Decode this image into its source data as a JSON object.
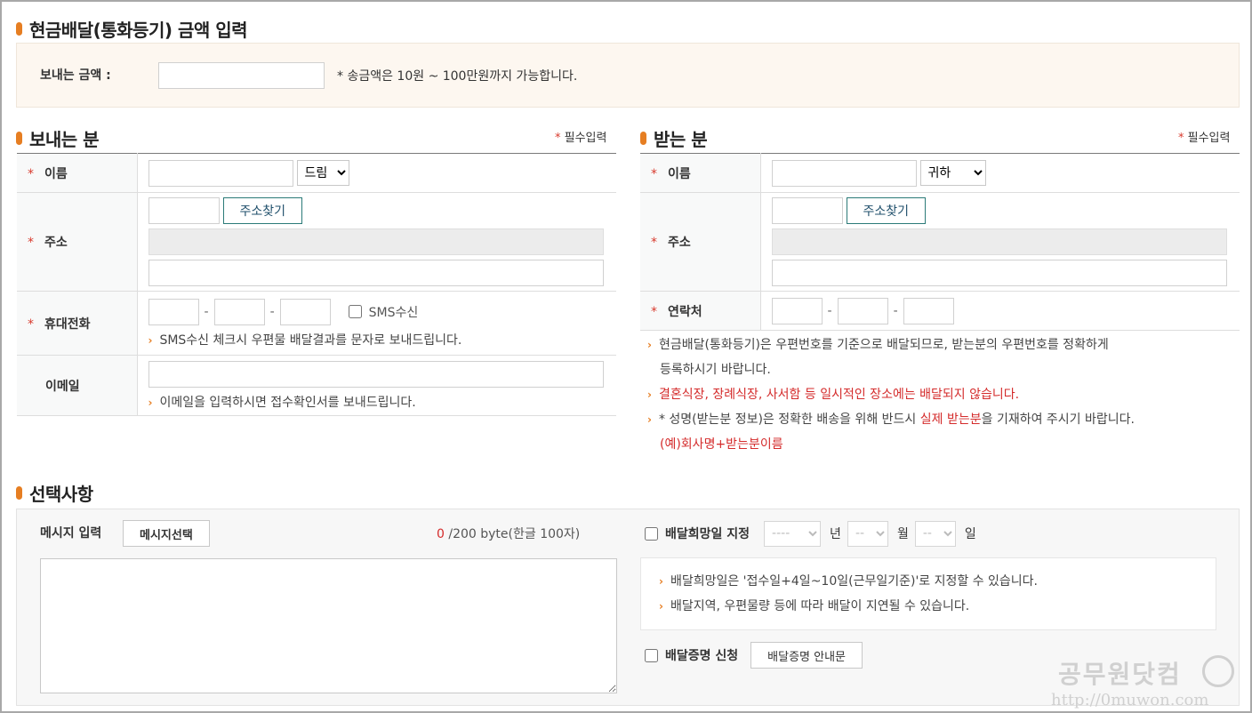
{
  "amount_section": {
    "title": "현금배달(통화등기) 금액 입력",
    "label": "보내는 금액 :",
    "note": "* 송금액은 10원 ~ 100만원까지 가능합니다."
  },
  "required_note": "필수입력",
  "sender": {
    "title": "보내는 분",
    "name_label": "이름",
    "honorific_selected": "드림",
    "address_label": "주소",
    "find_address_button": "주소찾기",
    "mobile_label": "휴대전화",
    "sms_label": "SMS수신",
    "sms_hint": "SMS수신 체크시 우편물 배달결과를 문자로 보내드립니다.",
    "email_label": "이메일",
    "email_hint": "이메일을 입력하시면 접수확인서를 보내드립니다."
  },
  "receiver": {
    "title": "받는 분",
    "name_label": "이름",
    "honorific_selected": "귀하",
    "address_label": "주소",
    "find_address_button": "주소찾기",
    "contact_label": "연락처",
    "notes": {
      "note1_line1": "현금배달(통화등기)은 우편번호를 기준으로 배달되므로, 받는분의 우편번호를 정확하게",
      "note1_line2": "등록하시기 바랍니다.",
      "note2": "결혼식장, 장례식장, 사서함 등 일시적인 장소에는 배달되지 않습니다.",
      "note3_pre": "* 성명(받는분 정보)은 정확한 배송을 위해 반드시 ",
      "note3_red": "실제 받는분",
      "note3_post": "을 기재하여 주시기 바랍니다.",
      "note3_example": "(예)회사명+받는분이름"
    }
  },
  "options": {
    "title": "선택사항",
    "message_label": "메시지 입력",
    "message_select_button": "메시지선택",
    "byte_count": "0",
    "byte_limit": "/200 byte(한글 100자)",
    "delivery_date_label": "배달희망일 지정",
    "year_placeholder": "----",
    "year_unit": "년",
    "month_placeholder": "--",
    "month_unit": "월",
    "day_placeholder": "--",
    "day_unit": "일",
    "info1": "배달희망일은 '접수일+4일~10일(근무일기준)'로 지정할 수 있습니다.",
    "info2": "배달지역, 우편물량 등에 따라 배달이 지연될 수 있습니다.",
    "proof_label": "배달증명 신청",
    "proof_guide_button": "배달증명 안내문"
  },
  "watermark": {
    "title": "공무원닷컴",
    "url": "http://0muwon.com"
  },
  "colors": {
    "accent": "#e67e22",
    "required_star": "#d83a2d",
    "warning_red": "#d42b2b",
    "button_border": "#2b7a78"
  }
}
